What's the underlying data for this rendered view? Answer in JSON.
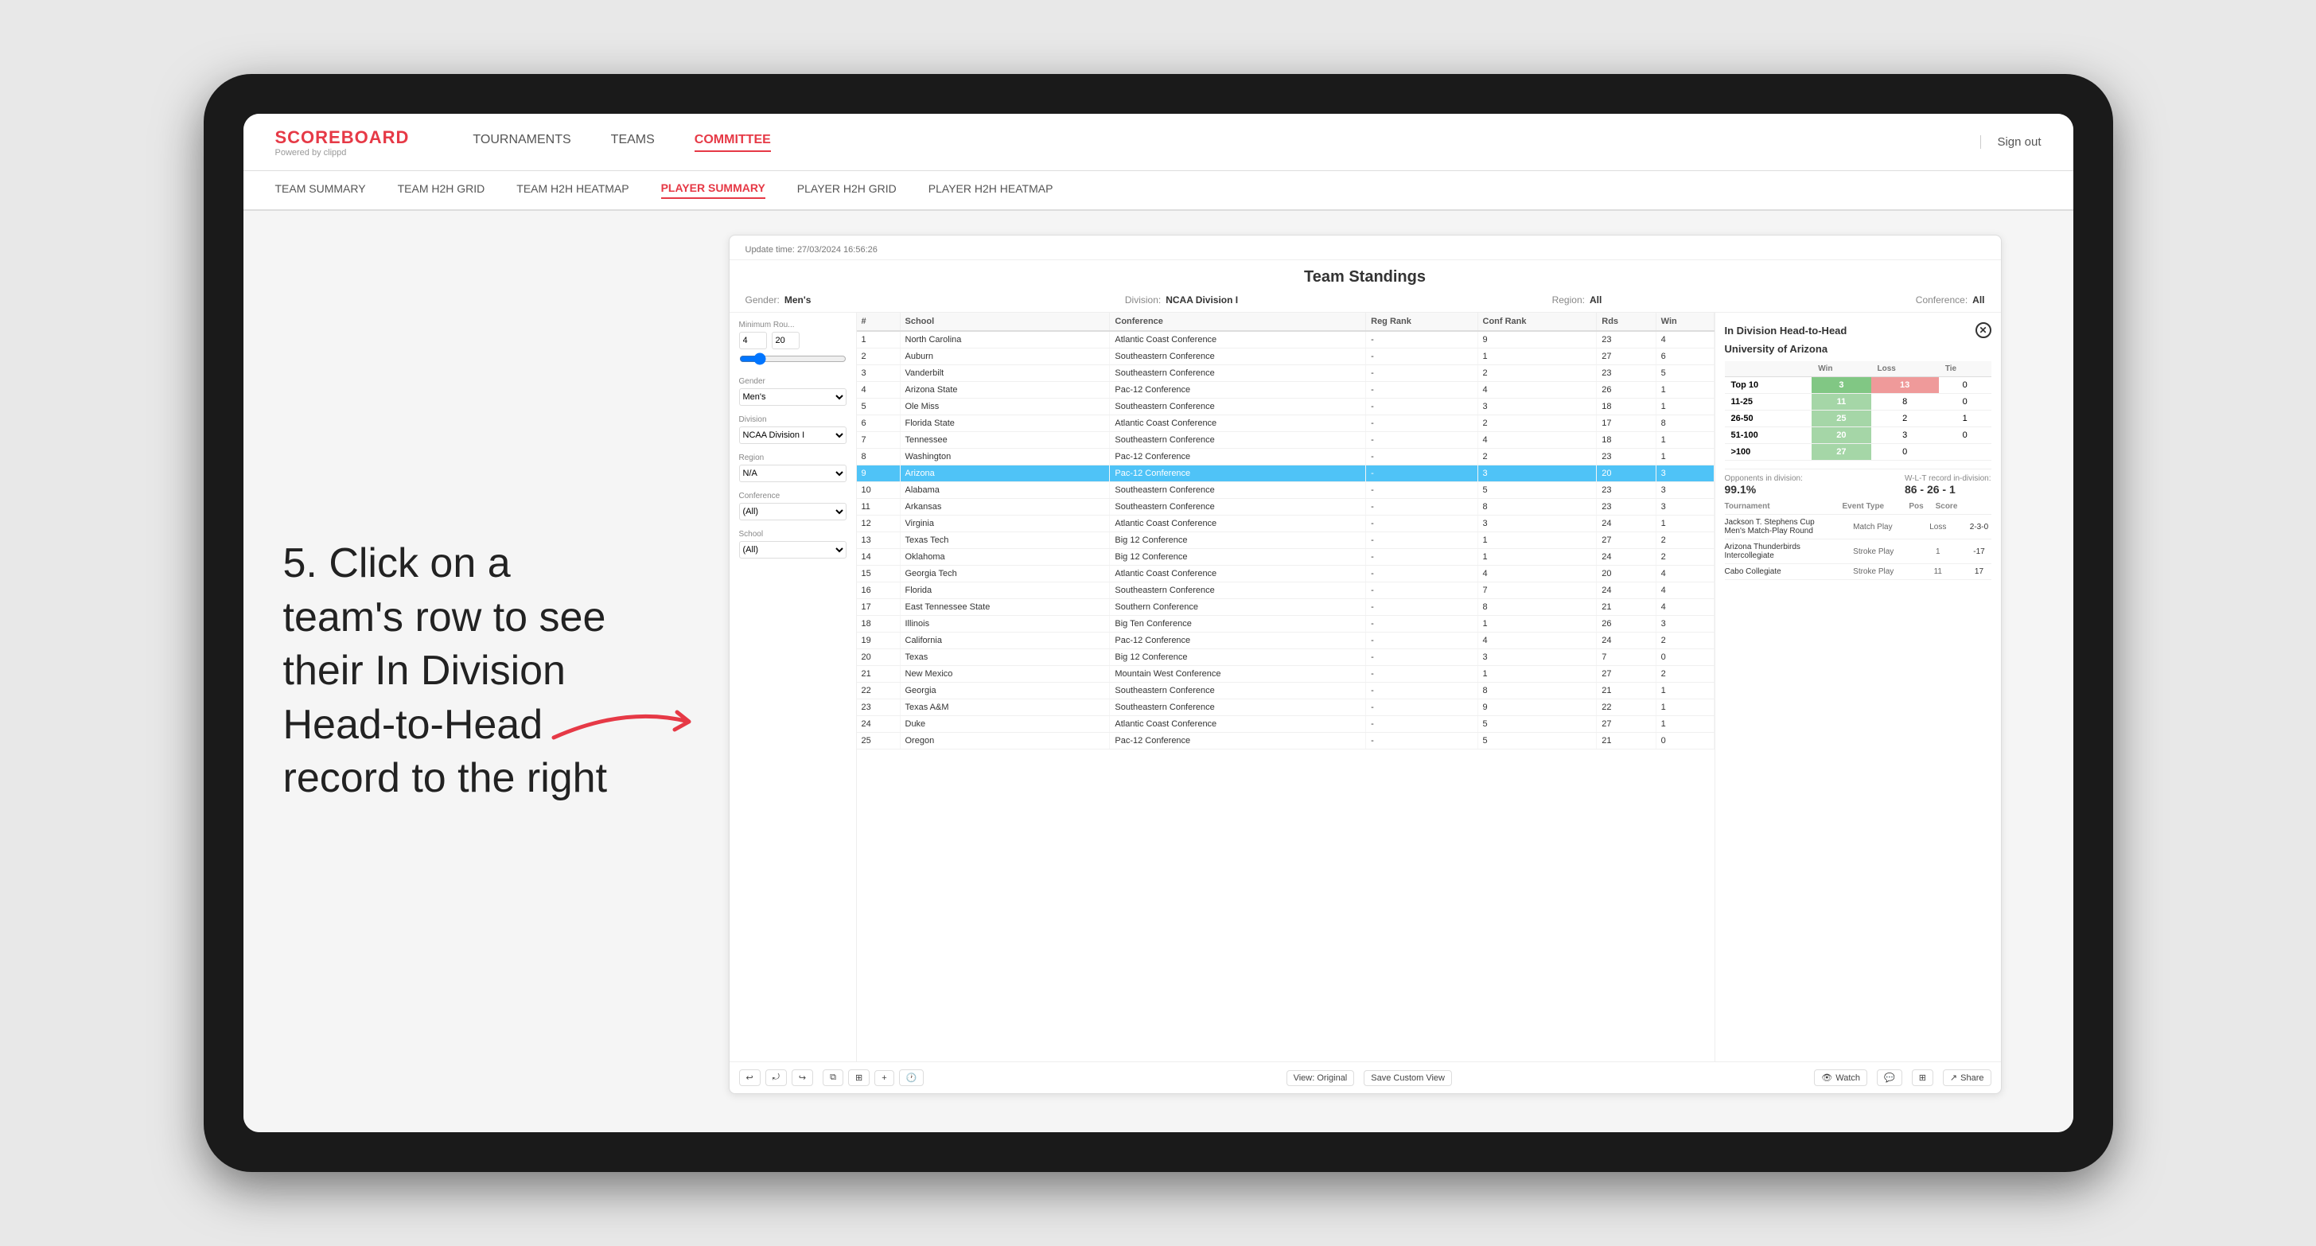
{
  "tablet": {
    "background": "#1a1a1a"
  },
  "topnav": {
    "logo": "SCOREBOARD",
    "logo_sub": "Powered by clippd",
    "links": [
      "TOURNAMENTS",
      "TEAMS",
      "COMMITTEE"
    ],
    "active_link": "COMMITTEE",
    "sign_out": "Sign out"
  },
  "subnav": {
    "links": [
      "TEAM SUMMARY",
      "TEAM H2H GRID",
      "TEAM H2H HEATMAP",
      "PLAYER SUMMARY",
      "PLAYER H2H GRID",
      "PLAYER H2H HEATMAP"
    ],
    "active_link": "PLAYER SUMMARY"
  },
  "annotation": {
    "text": "5. Click on a team's row to see their In Division Head-to-Head record to the right"
  },
  "window": {
    "update_time_label": "Update time:",
    "update_time": "27/03/2024 16:56:26",
    "title": "Team Standings",
    "filters": {
      "gender_label": "Gender:",
      "gender": "Men's",
      "division_label": "Division:",
      "division": "NCAA Division I",
      "region_label": "Region:",
      "region": "All",
      "conference_label": "Conference:",
      "conference": "All"
    },
    "sidebar": {
      "min_rounds_label": "Minimum Rou...",
      "min_rounds_value": "4",
      "min_rounds_max": "20",
      "gender_label": "Gender",
      "gender_value": "Men's",
      "division_label": "Division",
      "division_value": "NCAA Division I",
      "region_label": "Region",
      "region_value": "N/A",
      "conference_label": "Conference",
      "conference_value": "(All)",
      "school_label": "School",
      "school_value": "(All)"
    },
    "table": {
      "headers": [
        "#",
        "School",
        "Conference",
        "Reg Rank",
        "Conf Rank",
        "Rds",
        "Win"
      ],
      "rows": [
        {
          "num": "1",
          "school": "North Carolina",
          "conference": "Atlantic Coast Conference",
          "reg": "-",
          "conf": "9",
          "rds": "23",
          "win": "4"
        },
        {
          "num": "2",
          "school": "Auburn",
          "conference": "Southeastern Conference",
          "reg": "-",
          "conf": "1",
          "rds": "27",
          "win": "6"
        },
        {
          "num": "3",
          "school": "Vanderbilt",
          "conference": "Southeastern Conference",
          "reg": "-",
          "conf": "2",
          "rds": "23",
          "win": "5"
        },
        {
          "num": "4",
          "school": "Arizona State",
          "conference": "Pac-12 Conference",
          "reg": "-",
          "conf": "4",
          "rds": "26",
          "win": "1"
        },
        {
          "num": "5",
          "school": "Ole Miss",
          "conference": "Southeastern Conference",
          "reg": "-",
          "conf": "3",
          "rds": "18",
          "win": "1"
        },
        {
          "num": "6",
          "school": "Florida State",
          "conference": "Atlantic Coast Conference",
          "reg": "-",
          "conf": "2",
          "rds": "17",
          "win": "8"
        },
        {
          "num": "7",
          "school": "Tennessee",
          "conference": "Southeastern Conference",
          "reg": "-",
          "conf": "4",
          "rds": "18",
          "win": "1"
        },
        {
          "num": "8",
          "school": "Washington",
          "conference": "Pac-12 Conference",
          "reg": "-",
          "conf": "2",
          "rds": "23",
          "win": "1"
        },
        {
          "num": "9",
          "school": "Arizona",
          "conference": "Pac-12 Conference",
          "reg": "-",
          "conf": "3",
          "rds": "20",
          "win": "3",
          "selected": true
        },
        {
          "num": "10",
          "school": "Alabama",
          "conference": "Southeastern Conference",
          "reg": "-",
          "conf": "5",
          "rds": "23",
          "win": "3"
        },
        {
          "num": "11",
          "school": "Arkansas",
          "conference": "Southeastern Conference",
          "reg": "-",
          "conf": "8",
          "rds": "23",
          "win": "3"
        },
        {
          "num": "12",
          "school": "Virginia",
          "conference": "Atlantic Coast Conference",
          "reg": "-",
          "conf": "3",
          "rds": "24",
          "win": "1"
        },
        {
          "num": "13",
          "school": "Texas Tech",
          "conference": "Big 12 Conference",
          "reg": "-",
          "conf": "1",
          "rds": "27",
          "win": "2"
        },
        {
          "num": "14",
          "school": "Oklahoma",
          "conference": "Big 12 Conference",
          "reg": "-",
          "conf": "1",
          "rds": "24",
          "win": "2"
        },
        {
          "num": "15",
          "school": "Georgia Tech",
          "conference": "Atlantic Coast Conference",
          "reg": "-",
          "conf": "4",
          "rds": "20",
          "win": "4"
        },
        {
          "num": "16",
          "school": "Florida",
          "conference": "Southeastern Conference",
          "reg": "-",
          "conf": "7",
          "rds": "24",
          "win": "4"
        },
        {
          "num": "17",
          "school": "East Tennessee State",
          "conference": "Southern Conference",
          "reg": "-",
          "conf": "8",
          "rds": "21",
          "win": "4"
        },
        {
          "num": "18",
          "school": "Illinois",
          "conference": "Big Ten Conference",
          "reg": "-",
          "conf": "1",
          "rds": "26",
          "win": "3"
        },
        {
          "num": "19",
          "school": "California",
          "conference": "Pac-12 Conference",
          "reg": "-",
          "conf": "4",
          "rds": "24",
          "win": "2"
        },
        {
          "num": "20",
          "school": "Texas",
          "conference": "Big 12 Conference",
          "reg": "-",
          "conf": "3",
          "rds": "7",
          "win": "0"
        },
        {
          "num": "21",
          "school": "New Mexico",
          "conference": "Mountain West Conference",
          "reg": "-",
          "conf": "1",
          "rds": "27",
          "win": "2"
        },
        {
          "num": "22",
          "school": "Georgia",
          "conference": "Southeastern Conference",
          "reg": "-",
          "conf": "8",
          "rds": "21",
          "win": "1"
        },
        {
          "num": "23",
          "school": "Texas A&M",
          "conference": "Southeastern Conference",
          "reg": "-",
          "conf": "9",
          "rds": "22",
          "win": "1"
        },
        {
          "num": "24",
          "school": "Duke",
          "conference": "Atlantic Coast Conference",
          "reg": "-",
          "conf": "5",
          "rds": "27",
          "win": "1"
        },
        {
          "num": "25",
          "school": "Oregon",
          "conference": "Pac-12 Conference",
          "reg": "-",
          "conf": "5",
          "rds": "21",
          "win": "0"
        }
      ]
    },
    "right_panel": {
      "title": "In Division Head-to-Head",
      "team": "University of Arizona",
      "h2h_headers": [
        "",
        "Win",
        "Loss",
        "Tie"
      ],
      "h2h_rows": [
        {
          "label": "Top 10",
          "win": "3",
          "loss": "13",
          "tie": "0"
        },
        {
          "label": "11-25",
          "win": "11",
          "loss": "8",
          "tie": "0"
        },
        {
          "label": "26-50",
          "win": "25",
          "loss": "2",
          "tie": "1"
        },
        {
          "label": "51-100",
          "win": "20",
          "loss": "3",
          "tie": "0"
        },
        {
          "label": ">100",
          "win": "27",
          "loss": "0",
          "tie": ""
        }
      ],
      "opponents_label": "Opponents in division:",
      "opponents_value": "99.1%",
      "wlt_label": "W-L-T record in-division:",
      "wlt_value": "86 - 26 - 1",
      "tournament_headers": [
        "Tournament",
        "Event Type",
        "Pos",
        "Score"
      ],
      "tournament_rows": [
        {
          "name": "Jackson T. Stephens Cup Men's Match-Play Round",
          "event": "Match Play",
          "pos": "Loss",
          "score": "2-3-0"
        },
        {
          "name": "Arizona Thunderbirds Intercollegiate",
          "event": "Stroke Play",
          "pos": "1",
          "score": "-17"
        },
        {
          "name": "Cabo Collegiate",
          "event": "Stroke Play",
          "pos": "11",
          "score": "17"
        }
      ]
    },
    "toolbar": {
      "undo": "↩",
      "redo": "↪",
      "view_original": "View: Original",
      "save_custom": "Save Custom View",
      "watch": "Watch",
      "share": "Share"
    }
  }
}
